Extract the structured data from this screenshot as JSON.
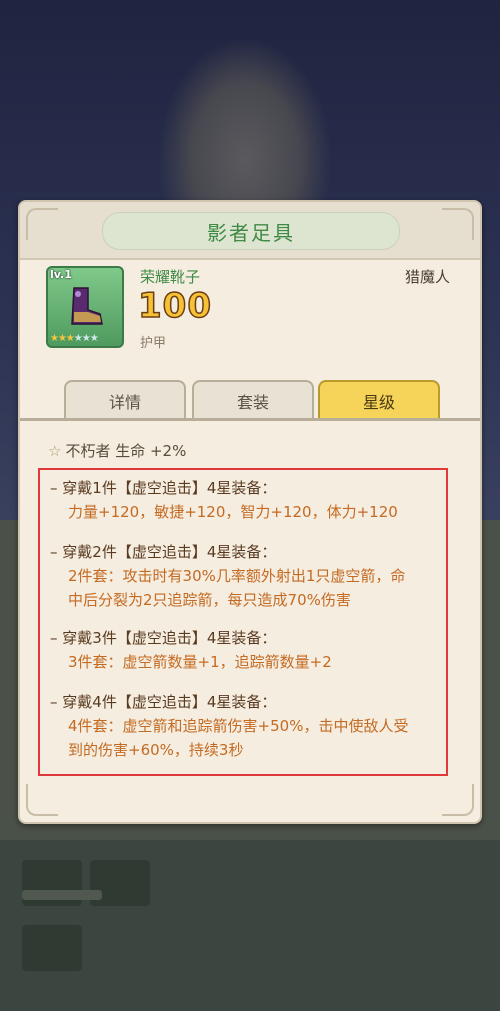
{
  "panel": {
    "title": "影者足具"
  },
  "item": {
    "level": "lv.1",
    "name": "荣耀靴子",
    "value": "100",
    "stat_label": "护甲",
    "class": "猎魔人",
    "stars_filled": 3,
    "stars_total": 6
  },
  "tabs": [
    {
      "label": "详情",
      "active": false
    },
    {
      "label": "套装",
      "active": false
    },
    {
      "label": "星级",
      "active": true
    }
  ],
  "passive": {
    "text": "不朽者 生命 +2%"
  },
  "set_bonus": [
    {
      "head": "穿戴1件【虚空追击】4星装备：",
      "desc1": "力量+120，敏捷+120，智力+120，体力+120",
      "desc2": ""
    },
    {
      "head": "穿戴2件【虚空追击】4星装备：",
      "desc1": "2件套：攻击时有30%几率额外射出1只虚空箭，命",
      "desc2": "中后分裂为2只追踪箭，每只造成70%伤害"
    },
    {
      "head": "穿戴3件【虚空追击】4星装备：",
      "desc1": "3件套：虚空箭数量+1，追踪箭数量+2",
      "desc2": ""
    },
    {
      "head": "穿戴4件【虚空追击】4星装备：",
      "desc1": "4件套：虚空箭和追踪箭伤害+50%，击中使敌人受",
      "desc2": "到的伤害+60%，持续3秒"
    }
  ],
  "colors": {
    "title_green": "#3f8a45",
    "value_gold": "#f6c136",
    "highlight_red": "#e0393b",
    "desc_orange": "#c56a22"
  },
  "icons": [
    "boot-icon",
    "star-icon",
    "diamond-icon"
  ]
}
